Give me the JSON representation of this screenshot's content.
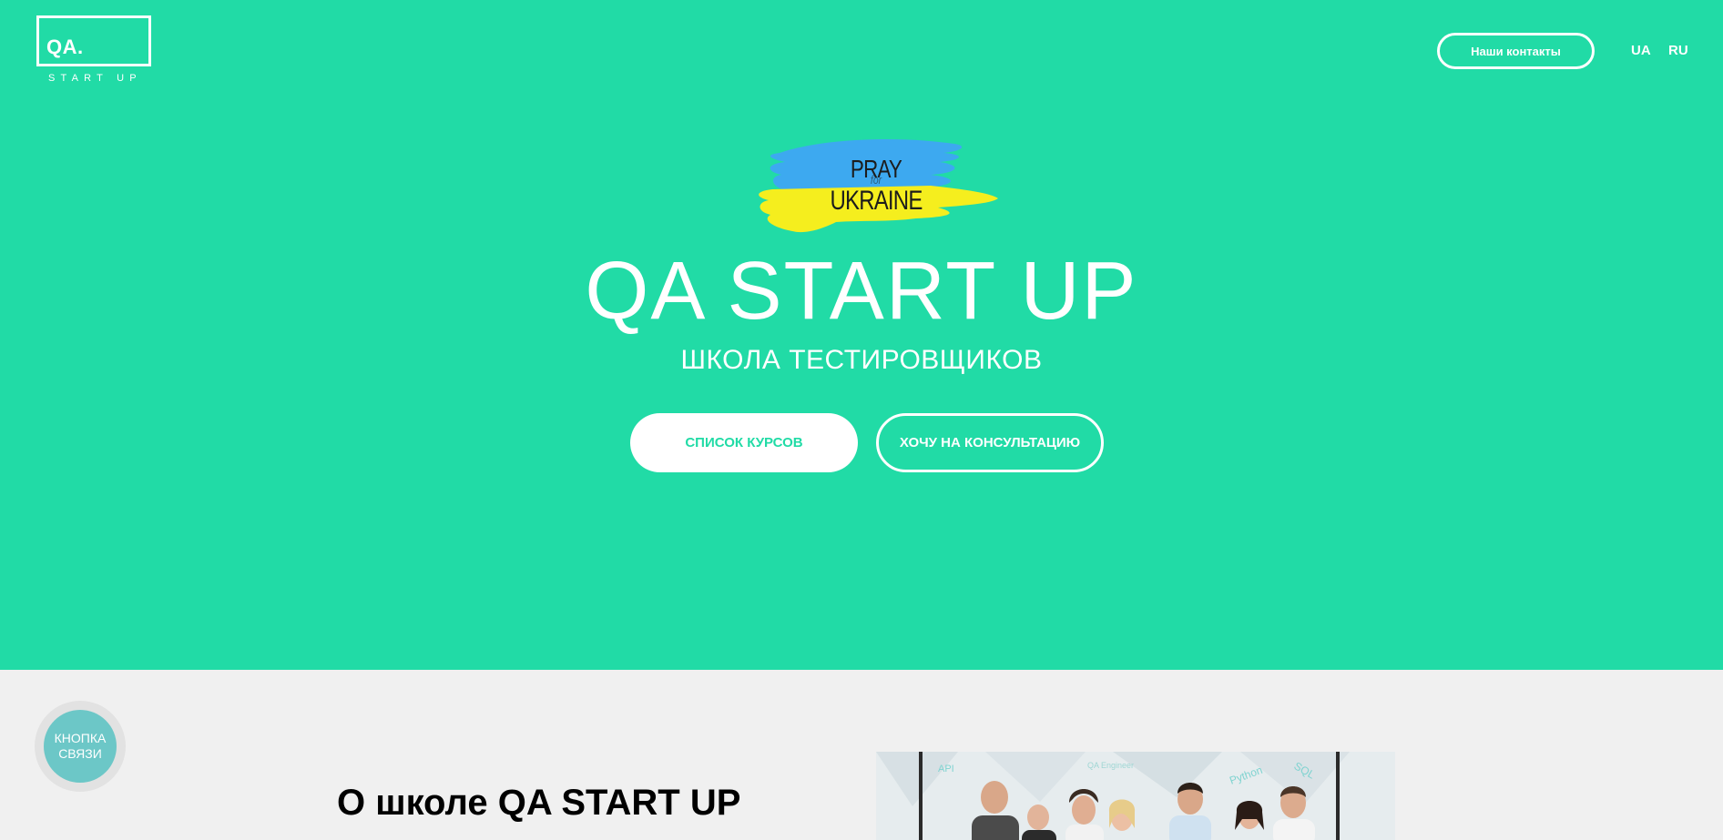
{
  "header": {
    "logo_main": "QA.",
    "logo_sub": "START UP",
    "contacts_button": "Наши контакты",
    "languages": [
      "UA",
      "RU"
    ]
  },
  "hero": {
    "badge_top": "PRAY",
    "badge_middle": "for",
    "badge_bottom": "UKRAINE",
    "title": "QA START UP",
    "subtitle": "ШКОЛА ТЕСТИРОВЩИКОВ",
    "primary_button": "СПИСОК КУРСОВ",
    "secondary_button": "ХОЧУ НА КОНСУЛЬТАЦИЮ",
    "background_color": "#21dba6"
  },
  "chat_widget": {
    "line1": "КНОПКА",
    "line2": "СВЯЗИ"
  },
  "about": {
    "title": "О школе QA START UP",
    "photo_words": [
      "API",
      "Python",
      "SQL",
      "QA Engineer"
    ]
  }
}
